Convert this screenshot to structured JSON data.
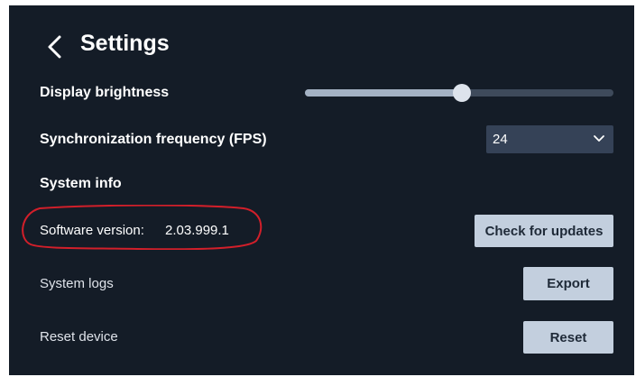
{
  "header": {
    "title": "Settings",
    "back_icon": "chevron-left-icon"
  },
  "brightness": {
    "label": "Display brightness",
    "level_percent": 51
  },
  "sync_frequency": {
    "label": "Synchronization frequency (FPS)",
    "selected": "24",
    "dropdown_icon": "chevron-down-icon"
  },
  "system_info": {
    "heading": "System info",
    "software_version_label": "Software version:",
    "software_version_value": "2.03.999.1",
    "check_updates_label": "Check for updates"
  },
  "system_logs": {
    "label": "System logs",
    "button_label": "Export"
  },
  "reset_device": {
    "label": "Reset device",
    "button_label": "Reset"
  },
  "colors": {
    "panel_background": "#141c27",
    "button_background": "#c3cfde",
    "select_background": "#354257",
    "slider_fill": "#a4b2c4",
    "slider_track": "#3e4a5b",
    "highlight_ring": "#d21f2a"
  }
}
